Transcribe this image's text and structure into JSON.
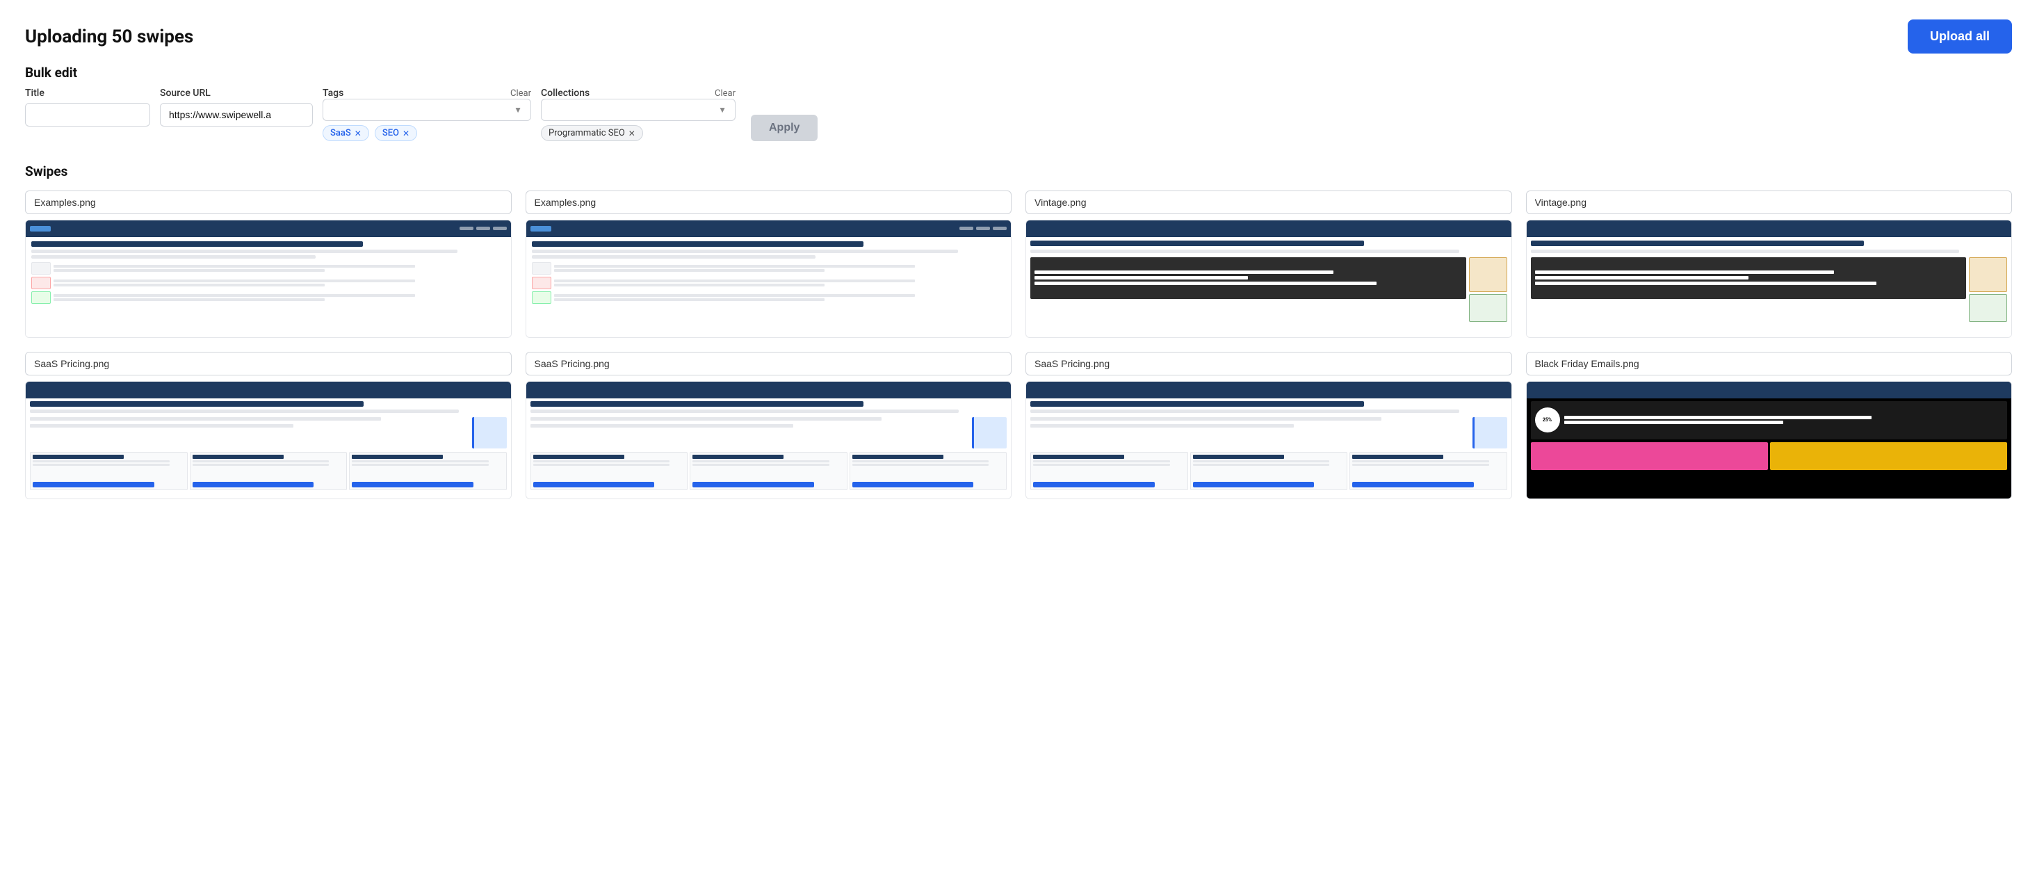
{
  "header": {
    "title": "Uploading 50 swipes",
    "upload_all_label": "Upload all"
  },
  "bulk_edit": {
    "section_label": "Bulk edit",
    "title_label": "Title",
    "source_url_label": "Source URL",
    "source_url_value": "https://www.swipewell.a",
    "tags_label": "Tags",
    "tags_clear_label": "Clear",
    "collections_label": "Collections",
    "collections_clear_label": "Clear",
    "apply_label": "Apply",
    "active_tags": [
      {
        "id": "saas",
        "label": "SaaS"
      },
      {
        "id": "seo",
        "label": "SEO"
      }
    ],
    "active_collections": [
      {
        "id": "prog-seo",
        "label": "Programmatic SEO"
      }
    ]
  },
  "swipes_section": {
    "label": "Swipes",
    "items": [
      {
        "id": 1,
        "filename": "Examples.png",
        "type": "marketing"
      },
      {
        "id": 2,
        "filename": "Examples.png",
        "type": "marketing"
      },
      {
        "id": 3,
        "filename": "Vintage.png",
        "type": "vintage"
      },
      {
        "id": 4,
        "filename": "Vintage.png",
        "type": "vintage"
      },
      {
        "id": 5,
        "filename": "SaaS Pricing.png",
        "type": "saas"
      },
      {
        "id": 6,
        "filename": "SaaS Pricing.png",
        "type": "saas"
      },
      {
        "id": 7,
        "filename": "SaaS Pricing.png",
        "type": "saas"
      },
      {
        "id": 8,
        "filename": "Black Friday Emails.png",
        "type": "blackfriday"
      }
    ]
  },
  "colors": {
    "primary": "#2563eb",
    "apply_disabled": "#d1d5db",
    "apply_disabled_text": "#6b7280"
  }
}
